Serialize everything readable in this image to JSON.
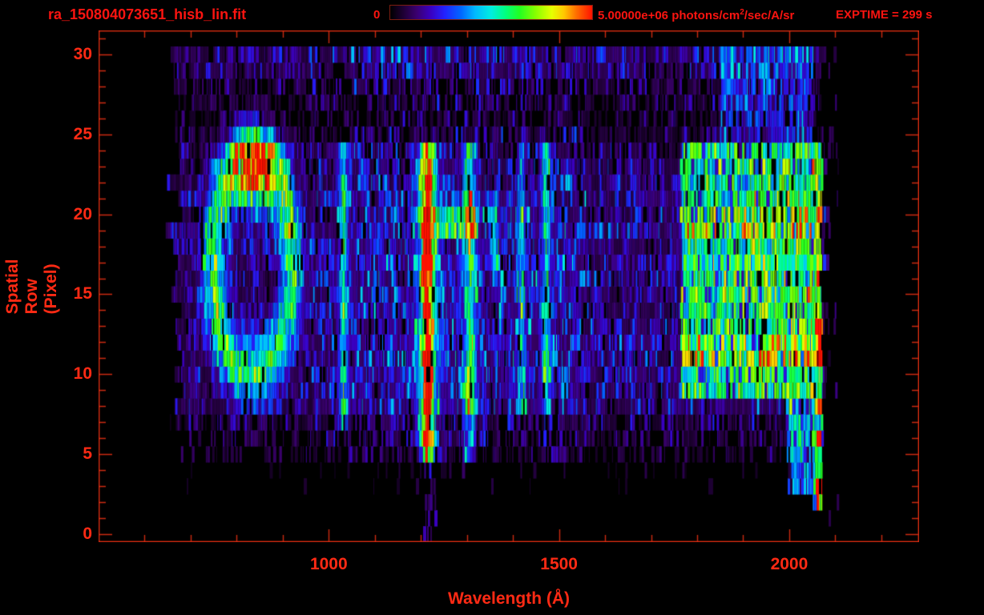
{
  "header": {
    "title": "ra_150804073651_hisb_lin.fit",
    "colorbar_min": "0",
    "colorbar_max": "5.00000e+06",
    "units_prefix": "photons/cm",
    "units_sup": "2",
    "units_suffix": "/sec/A/sr",
    "exptime": "EXPTIME = 299 s"
  },
  "colors": {
    "header_red": "#fb1410",
    "label_red": "#ff2a14",
    "axis_red": "#cc2a10",
    "background": "#000000",
    "colormap": [
      [
        0.0,
        "#000000"
      ],
      [
        0.06,
        "#1c0030"
      ],
      [
        0.13,
        "#3a006e"
      ],
      [
        0.2,
        "#3a00c0"
      ],
      [
        0.27,
        "#2222ff"
      ],
      [
        0.35,
        "#0066ff"
      ],
      [
        0.42,
        "#00b8ff"
      ],
      [
        0.5,
        "#00eee0"
      ],
      [
        0.57,
        "#00ff80"
      ],
      [
        0.64,
        "#22ff22"
      ],
      [
        0.72,
        "#88ff00"
      ],
      [
        0.8,
        "#e6ff00"
      ],
      [
        0.86,
        "#ffc800"
      ],
      [
        0.92,
        "#ff7000"
      ],
      [
        1.0,
        "#ff1200"
      ]
    ]
  },
  "chart_data": {
    "type": "heatmap",
    "title": "ra_150804073651_hisb_lin.fit",
    "xlabel": "Wavelength (Å)",
    "ylabel": "Spatial Row (Pixel)",
    "xlim": [
      500,
      2282
    ],
    "ylim": [
      -0.5,
      31.5
    ],
    "x_ticks": [
      1000,
      1500,
      2000
    ],
    "x_minor_step": 100,
    "y_ticks": [
      0,
      5,
      10,
      15,
      20,
      25,
      30
    ],
    "y_minor_step": 1,
    "colorbar": {
      "min": 0,
      "max": 5000000,
      "units": "photons/cm2/sec/A/sr"
    },
    "exptime_s": 299,
    "data_extent": {
      "wavelength": [
        665,
        2075
      ],
      "rows": [
        0,
        30
      ]
    },
    "row_envelope": [
      0.02,
      0.03,
      0.06,
      0.12,
      0.15,
      0.3,
      0.4,
      0.42,
      0.6,
      0.62,
      0.63,
      0.65,
      0.65,
      0.62,
      0.62,
      0.63,
      0.62,
      0.62,
      0.65,
      0.68,
      0.65,
      0.62,
      0.58,
      0.55,
      0.5,
      0.38,
      0.33,
      0.36,
      0.4,
      0.55,
      0.6,
      0.0
    ],
    "noise_column_factor": [
      [
        665,
        960,
        0.85
      ],
      [
        960,
        1050,
        1.05
      ],
      [
        1050,
        1560,
        1.3
      ],
      [
        1560,
        1765,
        1.0
      ],
      [
        1765,
        2075,
        1.1
      ]
    ],
    "features": [
      {
        "id": "ring",
        "type": "ring",
        "center_wavelength": 835,
        "center_row": 17,
        "radius_wavelength": 85,
        "radius_rows": 6.8,
        "thickness": 0.2,
        "intensity": 0.5
      },
      {
        "id": "ring-cap-blob",
        "type": "blob",
        "wavelength": 840,
        "row": 22.6,
        "sigma_wavelength": 38,
        "sigma_rows": 1.6,
        "intensity": 0.6
      },
      {
        "id": "line-1032",
        "type": "line",
        "wavelength": 1032,
        "sigma": 7,
        "rows": [
          7,
          24
        ],
        "intensity": 0.4
      },
      {
        "id": "lyman-alpha-1216",
        "type": "line",
        "wavelength": 1215,
        "sigma": 8,
        "rows": [
          5,
          24
        ],
        "intensity": 0.85,
        "halo_sigma": 20,
        "halo_intensity": 0.26,
        "hot_rows": [
          [
            6,
            9
          ],
          [
            17,
            22
          ]
        ],
        "hot_intensity": 1.0,
        "cool_rows": [
          [
            5,
            5
          ],
          [
            23,
            24
          ]
        ],
        "cool_intensity": 0.62
      },
      {
        "id": "lyman-alpha-low-tail",
        "type": "patch",
        "wavelength": [
          1205,
          1235
        ],
        "rows": [
          0,
          4
        ],
        "intensity": 0.16,
        "sparse": 0.5
      },
      {
        "id": "bridge-1270",
        "type": "patch",
        "wavelength": [
          1225,
          1325
        ],
        "rows": [
          19,
          20
        ],
        "intensity": 0.3
      },
      {
        "id": "line-oi-1304",
        "type": "line",
        "wavelength": 1306,
        "sigma": 9,
        "rows": [
          5,
          24
        ],
        "intensity": 0.42,
        "hot_rows": [
          [
            8,
            10
          ],
          [
            18,
            21
          ]
        ],
        "hot_intensity": 0.52
      },
      {
        "id": "line-1360",
        "type": "line",
        "wavelength": 1360,
        "sigma": 6,
        "rows": [
          17,
          21
        ],
        "intensity": 0.3
      },
      {
        "id": "line-1418",
        "type": "line",
        "wavelength": 1418,
        "sigma": 6,
        "rows": [
          8,
          24
        ],
        "intensity": 0.27
      },
      {
        "id": "line-1470",
        "type": "line",
        "wavelength": 1472,
        "sigma": 7,
        "rows": [
          8,
          24
        ],
        "intensity": 0.33
      },
      {
        "id": "continuum-band",
        "type": "patch",
        "wavelength": [
          1765,
          2052
        ],
        "rows": [
          9,
          24
        ],
        "intensity": 0.4,
        "row_boosts": {
          "11": 0.15,
          "12": 0.15,
          "19": 0.12,
          "20": 0.1
        },
        "ramp": 0.1,
        "gap": 0.18,
        "gap_factor": 0.25
      },
      {
        "id": "continuum-band-upper-rows",
        "type": "patch",
        "wavelength": [
          1850,
          2052
        ],
        "rows": [
          25,
          30
        ],
        "intensity": 0.2,
        "gap": 0.2,
        "gap_factor": 0.3
      },
      {
        "id": "continuum-band-lower-wedge",
        "type": "patch",
        "wavelength": [
          1995,
          2052
        ],
        "rows": [
          3,
          8
        ],
        "intensity": 0.38,
        "gap": 0.2,
        "gap_factor": 0.3
      },
      {
        "id": "edge-column-2060",
        "type": "patch",
        "wavelength": [
          2052,
          2072
        ],
        "rows": [
          2,
          24
        ],
        "intensity": 0.5
      },
      {
        "id": "edge-hot-spots",
        "type": "patch",
        "wavelength": [
          2058,
          2072
        ],
        "rows": [
          2,
          24
        ],
        "intensity": 0.5,
        "only_rows": [
          2,
          3,
          6,
          8,
          11,
          12,
          13,
          16,
          19,
          20
        ]
      },
      {
        "id": "overscan-specks",
        "type": "patch",
        "wavelength": [
          2076,
          2108
        ],
        "rows": [
          1,
          30
        ],
        "intensity": 0.12,
        "sparse": 0.14
      }
    ]
  }
}
